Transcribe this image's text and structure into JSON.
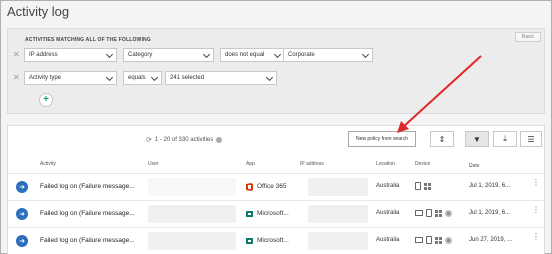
{
  "page": {
    "title": "Activity log"
  },
  "filters": {
    "heading": "ACTIVITIES MATCHING ALL OF THE FOLLOWING",
    "basic_label": "Basic",
    "rows": [
      {
        "field": "IP address",
        "param": "Category",
        "operator": "does not equal",
        "value": "Corporate"
      },
      {
        "field": "Activity type",
        "operator": "equals",
        "value": "241 selected"
      }
    ],
    "add_label": "+"
  },
  "results": {
    "count_text": "1 - 20 of 330 activities",
    "new_policy_label": "New policy from search",
    "columns": {
      "activity": "Activity",
      "user": "User",
      "app": "App",
      "ip": "IP address",
      "location": "Location",
      "device": "Device",
      "date": "Date"
    },
    "rows": [
      {
        "activity": "Failed log on (Failure message...",
        "app": "Office 365",
        "app_icon": "office365-icon",
        "location": "Australia",
        "date": "Jul 1, 2019, 6..."
      },
      {
        "activity": "Failed log on (Failure message...",
        "app": "Microsoft...",
        "app_icon": "exchange-icon",
        "location": "Australia",
        "date": "Jul 1, 2019, 6..."
      },
      {
        "activity": "Failed log on (Failure message...",
        "app": "Microsoft...",
        "app_icon": "exchange-icon",
        "location": "Australia",
        "date": "Jun 27, 2019, ..."
      }
    ]
  },
  "colors": {
    "accent_arrow": "#e0282a",
    "activity_icon": "#2a6ebd",
    "add_button": "#1aa07a",
    "office_red": "#d83b01",
    "exchange_teal": "#0f7b6c"
  }
}
